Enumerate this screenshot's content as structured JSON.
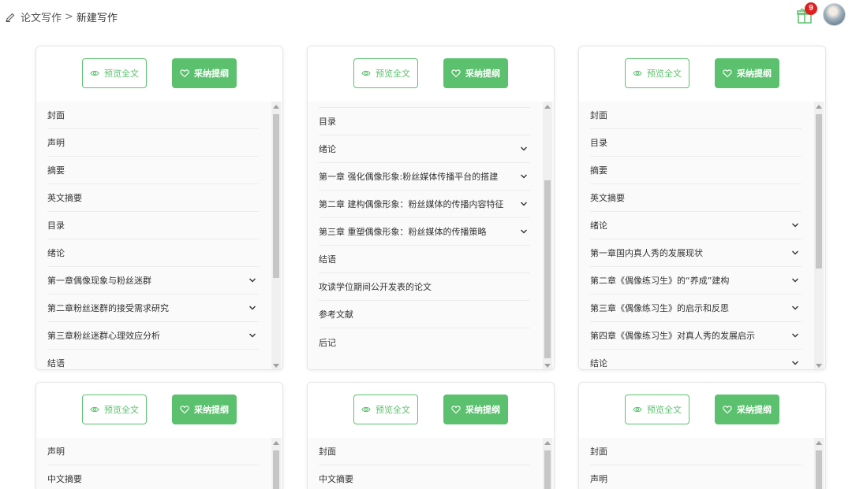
{
  "breadcrumb": {
    "parent": "论文写作",
    "separator": ">",
    "current": "新建写作"
  },
  "notifications": {
    "count": "9"
  },
  "cards": [
    {
      "preview_label": "预览全文",
      "adopt_label": "采纳提纲",
      "items": [
        {
          "label": "封面",
          "expandable": false
        },
        {
          "label": "声明",
          "expandable": false
        },
        {
          "label": "摘要",
          "expandable": false
        },
        {
          "label": "英文摘要",
          "expandable": false
        },
        {
          "label": "目录",
          "expandable": false
        },
        {
          "label": "绪论",
          "expandable": false
        },
        {
          "label": "第一章偶像现象与粉丝迷群",
          "expandable": true
        },
        {
          "label": "第二章粉丝迷群的接受需求研究",
          "expandable": true
        },
        {
          "label": "第三章粉丝迷群心理效应分析",
          "expandable": true
        },
        {
          "label": "结语",
          "expandable": false
        }
      ]
    },
    {
      "preview_label": "预览全文",
      "adopt_label": "采纳提纲",
      "items": [
        {
          "label": "目录",
          "expandable": false
        },
        {
          "label": "绪论",
          "expandable": true
        },
        {
          "label": "第一章 强化偶像形象:粉丝媒体传播平台的搭建",
          "expandable": true
        },
        {
          "label": "第二章 建构偶像形象：粉丝媒体的传播内容特征",
          "expandable": true
        },
        {
          "label": "第三章 重塑偶像形象：粉丝媒体的传播策略",
          "expandable": true
        },
        {
          "label": "结语",
          "expandable": false
        },
        {
          "label": "攻读学位期间公开发表的论文",
          "expandable": false
        },
        {
          "label": "参考文献",
          "expandable": false
        },
        {
          "label": "后记",
          "expandable": false
        }
      ]
    },
    {
      "preview_label": "预览全文",
      "adopt_label": "采纳提纲",
      "items": [
        {
          "label": "封面",
          "expandable": false
        },
        {
          "label": "目录",
          "expandable": false
        },
        {
          "label": "摘要",
          "expandable": false
        },
        {
          "label": "英文摘要",
          "expandable": false
        },
        {
          "label": "绪论",
          "expandable": true
        },
        {
          "label": "第一章国内真人秀的发展现状",
          "expandable": true
        },
        {
          "label": "第二章《偶像练习生》的“养成”建构",
          "expandable": true
        },
        {
          "label": "第三章《偶像练习生》的启示和反思",
          "expandable": true
        },
        {
          "label": "第四章《偶像练习生》对真人秀的发展启示",
          "expandable": true
        },
        {
          "label": "结论",
          "expandable": true
        }
      ]
    },
    {
      "preview_label": "预览全文",
      "adopt_label": "采纳提纲",
      "items": [
        {
          "label": "声明",
          "expandable": false
        },
        {
          "label": "中文摘要",
          "expandable": false
        }
      ]
    },
    {
      "preview_label": "预览全文",
      "adopt_label": "采纳提纲",
      "items": [
        {
          "label": "封面",
          "expandable": false
        },
        {
          "label": "中文摘要",
          "expandable": false
        }
      ]
    },
    {
      "preview_label": "预览全文",
      "adopt_label": "采纳提纲",
      "items": [
        {
          "label": "封面",
          "expandable": false
        },
        {
          "label": "声明",
          "expandable": false
        }
      ]
    }
  ]
}
